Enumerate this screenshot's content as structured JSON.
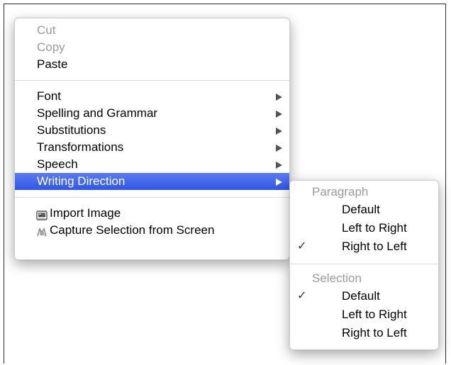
{
  "context_menu": {
    "edit_items": [
      {
        "label": "Cut",
        "enabled": false
      },
      {
        "label": "Copy",
        "enabled": false
      },
      {
        "label": "Paste",
        "enabled": true
      }
    ],
    "submenu_items": [
      {
        "label": "Font",
        "has_submenu": true
      },
      {
        "label": "Spelling and Grammar",
        "has_submenu": true
      },
      {
        "label": "Substitutions",
        "has_submenu": true
      },
      {
        "label": "Transformations",
        "has_submenu": true
      },
      {
        "label": "Speech",
        "has_submenu": true
      },
      {
        "label": "Writing Direction",
        "has_submenu": true,
        "highlighted": true
      }
    ],
    "action_items": [
      {
        "label": "Import Image",
        "icon": "image-icon"
      },
      {
        "label": "Capture Selection from Screen",
        "icon": "camera-capture-icon"
      }
    ]
  },
  "writing_direction_submenu": {
    "paragraph": {
      "header": "Paragraph",
      "options": [
        {
          "label": "Default",
          "checked": false
        },
        {
          "label": "Left to Right",
          "checked": false
        },
        {
          "label": "Right to Left",
          "checked": true
        }
      ]
    },
    "selection": {
      "header": "Selection",
      "options": [
        {
          "label": "Default",
          "checked": true
        },
        {
          "label": "Left to Right",
          "checked": false
        },
        {
          "label": "Right to Left",
          "checked": false
        }
      ]
    },
    "check_glyph": "✓"
  },
  "colors": {
    "highlight": "#3a5ee8",
    "disabled_text": "#9a9a9a",
    "text": "#000000"
  }
}
